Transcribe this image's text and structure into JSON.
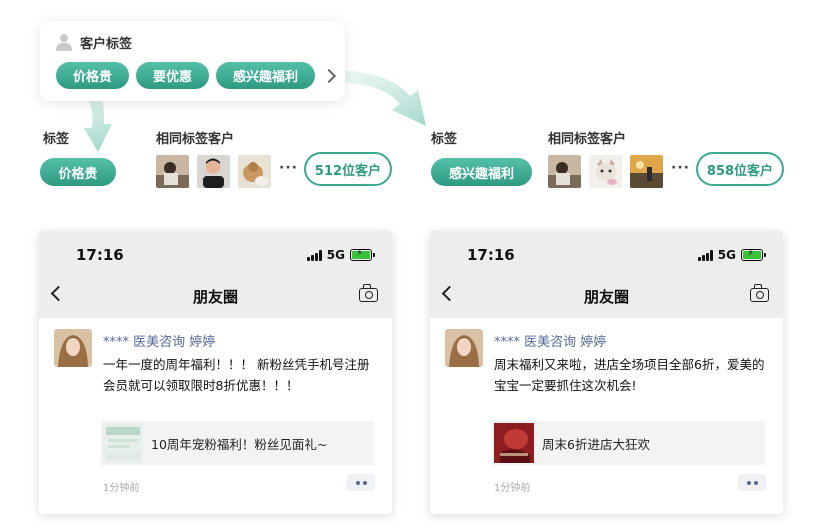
{
  "tag_card": {
    "title": "客户标签",
    "chips": [
      "价格贵",
      "要优惠",
      "感兴趣福利"
    ]
  },
  "left_group": {
    "tag_label": "标签",
    "tag_value": "价格贵",
    "same_label": "相同标签客户",
    "count": "512位客户"
  },
  "right_group": {
    "tag_label": "标签",
    "tag_value": "感兴趣福利",
    "same_label": "相同标签客户",
    "count": "858位客户"
  },
  "phones": [
    {
      "time": "17:16",
      "network": "5G",
      "nav_title": "朋友圈",
      "post_name": "**** 医美咨询 婷婷",
      "post_text": "一年一度的周年福利！！！ 新粉丝凭手机号注册会员就可以领取限时8折优惠！！！",
      "link_text": "10周年宠粉福利！粉丝见面礼~",
      "post_time": "1分钟前"
    },
    {
      "time": "17:16",
      "network": "5G",
      "nav_title": "朋友圈",
      "post_name": "**** 医美咨询 婷婷",
      "post_text": "周末福利又来啦，进店全场项目全部6折，爱美的宝宝一定要抓住这次机会!",
      "link_text": "周末6折进店大狂欢",
      "post_time": "1分钟前"
    }
  ],
  "colors": {
    "accent": "#3aaa91",
    "link_name": "#576b95"
  }
}
